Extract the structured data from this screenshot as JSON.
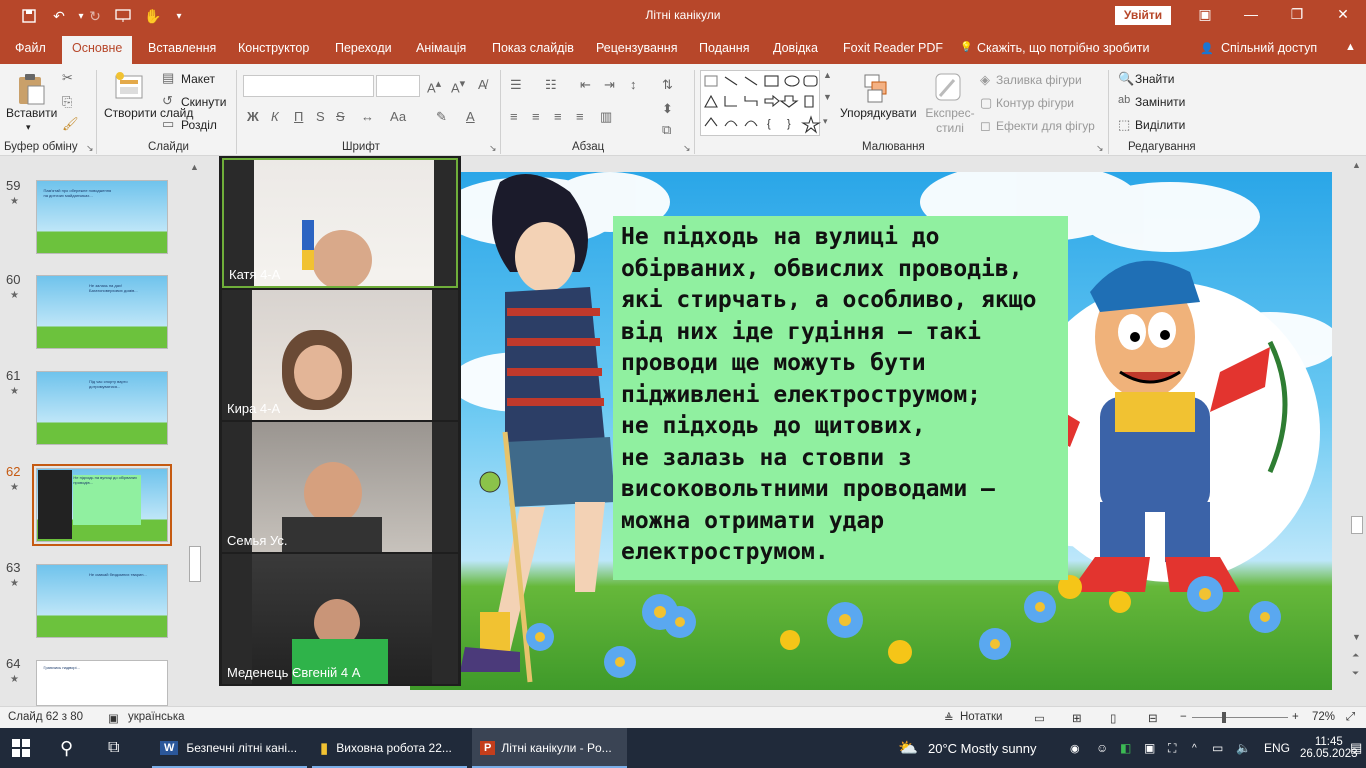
{
  "titlebar": {
    "title": "Літні канікули",
    "signin": "Увійти"
  },
  "tabs": [
    {
      "label": "Файл"
    },
    {
      "label": "Основне"
    },
    {
      "label": "Вставлення"
    },
    {
      "label": "Конструктор"
    },
    {
      "label": "Переходи"
    },
    {
      "label": "Анімація"
    },
    {
      "label": "Показ слайдів"
    },
    {
      "label": "Рецензування"
    },
    {
      "label": "Подання"
    },
    {
      "label": "Довідка"
    },
    {
      "label": "Foxit Reader PDF"
    },
    {
      "label": "Скажіть, що потрібно зробити"
    },
    {
      "label": "Спільний доступ"
    }
  ],
  "ribbon": {
    "paste": "Вставити",
    "clipboard_group": "Буфер обміну",
    "new_slide": "Створити слайд",
    "layout": "Макет",
    "reset": "Скинути",
    "section": "Розділ",
    "slides_group": "Слайди",
    "font_group": "Шрифт",
    "bold": "Ж",
    "italic": "К",
    "underline": "П",
    "strike": "S",
    "spacing": "Аа",
    "paragraph_group": "Абзац",
    "arrange": "Упорядкувати",
    "quick_styles": "Експрес-стилі",
    "shape_fill": "Заливка фігури",
    "shape_outline": "Контур фігури",
    "shape_effects": "Ефекти для фігур",
    "drawing_group": "Малювання",
    "find": "Знайти",
    "replace": "Замінити",
    "select": "Виділити",
    "editing_group": "Редагування"
  },
  "thumbnails": [
    {
      "num": "59",
      "star": "★",
      "text": "Пам'ятай про обережне поводження на дитячих майданчиках..."
    },
    {
      "num": "60",
      "star": "★",
      "text": "Не залазь на дах! Багатоповерхових домів..."
    },
    {
      "num": "61",
      "star": "★",
      "text": "Під час спорту варто дотримуватися..."
    },
    {
      "num": "62",
      "star": "★",
      "text": "Не підходь на вулиці до обірваних проводів..."
    },
    {
      "num": "63",
      "star": "★",
      "text": "Не смикай бездомних тварин..."
    },
    {
      "num": "64",
      "star": "★",
      "text": "Граючись надворі..."
    }
  ],
  "video": [
    {
      "name": "Катя  4-А"
    },
    {
      "name": "Кира 4-А"
    },
    {
      "name": "Семья Ус."
    },
    {
      "name": "Меденець Євгеній 4 А"
    }
  ],
  "slide": {
    "text": "Не підходь на вулиці до\nобірваних, обвислих проводів,\nякі стирчать, а особливо, якщо\nвід них іде гудіння – такі\nпроводи ще можуть бути\nпідживлені електрострумом;\nне підходь до щитових,\nне залазь на стовпи з\nвисоковольтними проводами –\nможна отримати удар\nелектрострумом."
  },
  "status": {
    "slide": "Слайд 62 з 80",
    "lang": "українська",
    "notes": "Нотатки",
    "zoom": "72%"
  },
  "taskbar": {
    "app1": "Безпечні літні кані...",
    "app2": "Виховна робота 22...",
    "app3": "Літні канікули - Po...",
    "weather": "20°C  Mostly sunny",
    "lang": "ENG",
    "time": "11:45",
    "date": "26.05.2023"
  },
  "colors": {
    "accent": "#b7472a",
    "textbox": "#90f0a0"
  }
}
